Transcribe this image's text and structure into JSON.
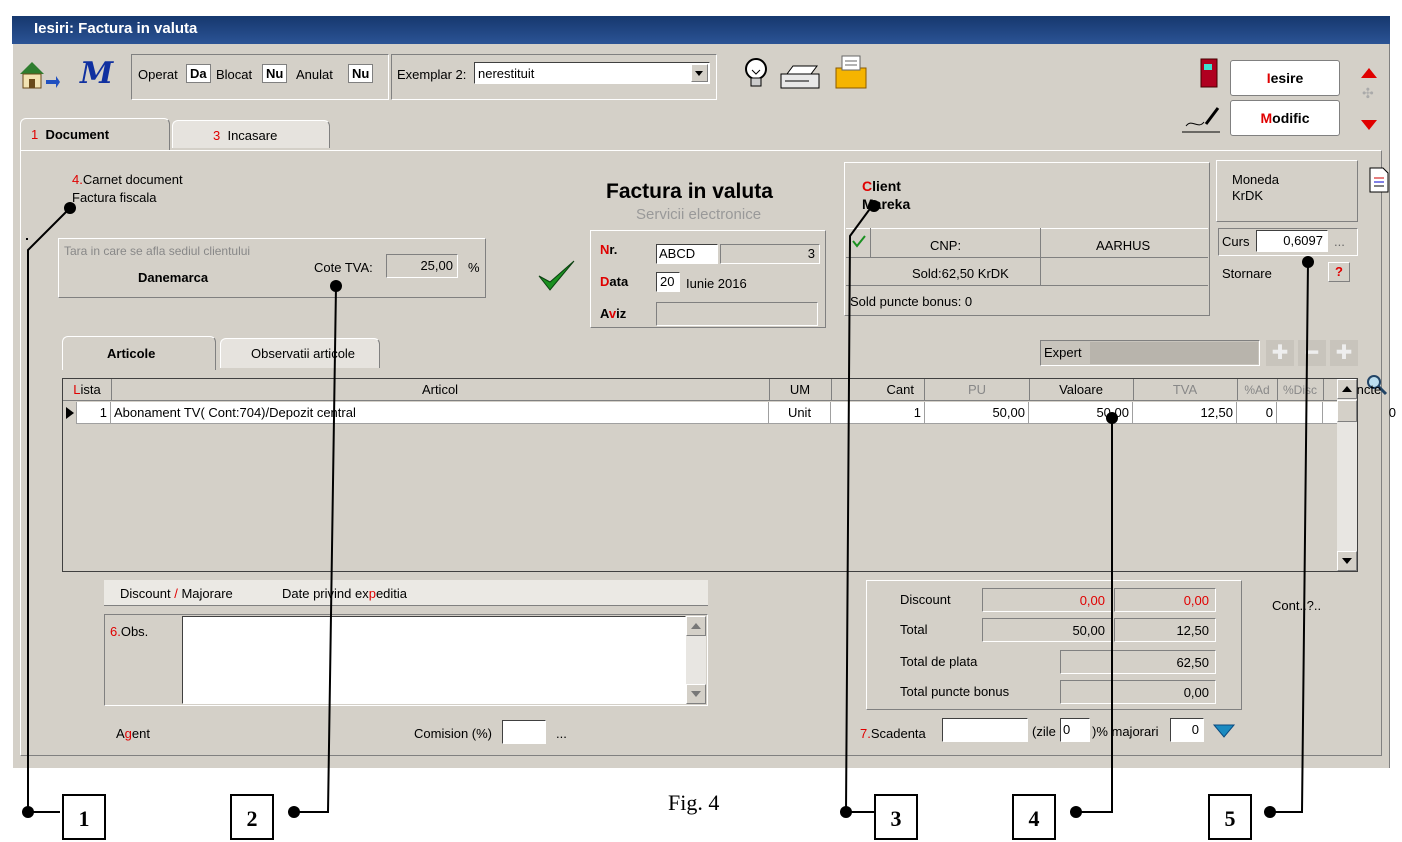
{
  "window": {
    "title": "Iesiri: Factura in valuta"
  },
  "toolbar": {
    "operat_label": "Operat",
    "operat_value": "Da",
    "blocat_label": "Blocat",
    "blocat_value": "Nu",
    "anulat_label": "Anulat",
    "anulat_value": "Nu",
    "exemplar_label": "Exemplar 2:",
    "exemplar_value": "nerestituit",
    "iesire_first": "I",
    "iesire_rest": "esire",
    "modific_first": "M",
    "modific_rest": "odific"
  },
  "tabs": [
    {
      "num": "1",
      "label": "Document"
    },
    {
      "num": "3",
      "label": "Incasare"
    }
  ],
  "carnet": {
    "num": "4.",
    "label": "Carnet document",
    "value": "Factura fiscala"
  },
  "tara": {
    "label": "Tara in care se afla sediul clientului",
    "value": "Danemarca",
    "tva_label": "Cote TVA:",
    "tva_value": "25,00",
    "tva_unit": "%"
  },
  "doc": {
    "title": "Factura in valuta",
    "subtitle": "Servicii electronice"
  },
  "nrdata": {
    "nr_first": "N",
    "nr_rest": "r.",
    "nr_series": "ABCD",
    "nr_value": "3",
    "data_first": "D",
    "data_rest": "ata",
    "data_day": "20",
    "data_month_year": "Iunie 2016",
    "aviz_a": "A",
    "aviz_v": "v",
    "aviz_rest": "iz"
  },
  "client": {
    "label_first": "C",
    "label_rest": "lient",
    "name": "Mareka",
    "cnp_label": "CNP:",
    "city": "AARHUS",
    "sold": "Sold:62,50 KrDK",
    "bonus": "Sold puncte bonus: 0"
  },
  "moneda": {
    "label": "Moneda",
    "value": "KrDK",
    "curs_label": "Curs",
    "curs_value": "0,6097",
    "dots": "...",
    "stornare": "Stornare",
    "q": "?"
  },
  "subtabs": [
    {
      "label": "Articole"
    },
    {
      "label": "Observatii articole"
    }
  ],
  "expert_label": "Expert",
  "grid": {
    "headers": {
      "lista_first": "L",
      "lista_rest": "ista",
      "articol": "Articol",
      "um": "UM",
      "cant": "Cant",
      "pu": "PU",
      "valoare": "Valoare",
      "tva": "TVA",
      "ad": "%Ad",
      "disc": "%Disc",
      "puncte": "Puncte"
    },
    "rows": [
      {
        "nr": "1",
        "articol": "Abonament TV( Cont:704)/Depozit central",
        "um": "Unit",
        "cant": "1",
        "pu": "50,00",
        "valoare": "50,00",
        "tva": "12,50",
        "ad": "0",
        "disc": "",
        "puncte": "0"
      }
    ]
  },
  "lower": {
    "discount_tab": "Discount",
    "slash": "/",
    "majorare_tab": "Majorare",
    "exped_tab_a": "Date privind ex",
    "exped_tab_p": "p",
    "exped_tab_b": "editia",
    "obs_num": "6.",
    "obs_label": "Obs.",
    "agent_a": "A",
    "agent_g": "g",
    "agent_rest": "ent",
    "comision_label": "Comision (%)",
    "comision_dots": "..."
  },
  "totals": {
    "discount_label": "Discount",
    "discount_v1": "0,00",
    "discount_v2": "0,00",
    "total_label": "Total",
    "total_v1": "50,00",
    "total_v2": "12,50",
    "plata_label": "Total de plata",
    "plata_v": "62,50",
    "bonus_label": "Total puncte bonus",
    "bonus_v": "0,00",
    "cont": "Cont..?.."
  },
  "scadenta": {
    "num": "7.",
    "label": "Scadenta",
    "zile_label": "(zile",
    "zile_value": "0",
    "maj_label": ")% majorari",
    "maj_value": "0"
  },
  "figure": {
    "caption": "Fig. 4",
    "callouts": [
      "1",
      "2",
      "3",
      "4",
      "5"
    ]
  },
  "colors": {
    "title_bar": "#1f4585",
    "window_bg": "#d4d0c8",
    "accent_red": "#e00000"
  }
}
